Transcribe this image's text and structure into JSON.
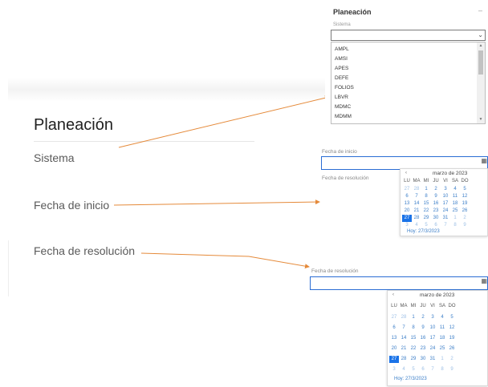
{
  "left_panel": {
    "title": "Planeación",
    "fields": [
      "Sistema",
      "Fecha de inicio",
      "Fecha de resolución"
    ]
  },
  "dropdown_panel": {
    "title": "Planeación",
    "dash": "–",
    "label": "Sistema",
    "selected_value": "",
    "options": [
      "AMPL",
      "AMSI",
      "APES",
      "DEFE",
      "FOLIOS",
      "LBVR",
      "MDMC",
      "MDMM"
    ]
  },
  "fecha_inicio": {
    "label": "Fecha de inicio",
    "value": "",
    "next_label": "Fecha de resolución"
  },
  "fecha_resolucion": {
    "label": "Fecha de resolución",
    "value": ""
  },
  "calendar": {
    "month_label": "marzo de 2023",
    "prev": "‹",
    "weekdays": [
      "LU",
      "MA",
      "MI",
      "JU",
      "VI",
      "SA",
      "DO"
    ],
    "weeks": [
      [
        "27",
        "28",
        "1",
        "2",
        "3",
        "4",
        "5"
      ],
      [
        "6",
        "7",
        "8",
        "9",
        "10",
        "11",
        "12"
      ],
      [
        "13",
        "14",
        "15",
        "16",
        "17",
        "18",
        "19"
      ],
      [
        "20",
        "21",
        "22",
        "23",
        "24",
        "25",
        "26"
      ],
      [
        "27",
        "28",
        "29",
        "30",
        "31",
        "1",
        "2"
      ],
      [
        "3",
        "4",
        "5",
        "6",
        "7",
        "8",
        "9"
      ]
    ],
    "selected": "27",
    "today_label": "Hoy: 27/3/2023"
  },
  "colors": {
    "accent": "#1a73e8",
    "arrow": "#e58a3a",
    "day_text": "#3b7ec8"
  },
  "icons": {
    "dropdown": "chevron-down-icon",
    "calendar": "calendar-icon"
  }
}
